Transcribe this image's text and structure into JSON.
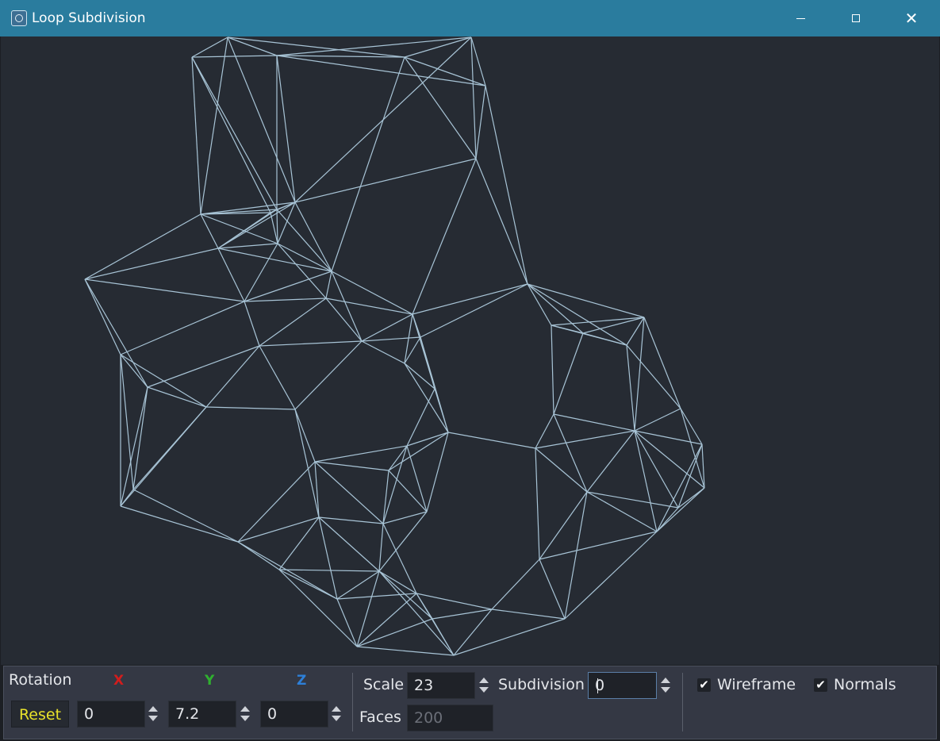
{
  "window": {
    "title": "Loop Subdivision",
    "icon": "app-icon",
    "close_glyph": "✕"
  },
  "colors": {
    "titlebar": "#2a7c9e",
    "viewport_bg": "#262b33",
    "wire": "#a8c4d6",
    "axis_x": "#d21d1d",
    "axis_y": "#2fb02f",
    "axis_z": "#2d7fd8",
    "reset_text": "#e8e22b"
  },
  "viewport": {
    "mesh": "wireframe-bunny"
  },
  "controls": {
    "rotation": {
      "label": "Rotation",
      "x_label": "X",
      "y_label": "Y",
      "z_label": "Z",
      "reset_label": "Reset",
      "x_value": "0",
      "y_value": "7.2",
      "z_value": "0"
    },
    "scale": {
      "label": "Scale",
      "value": "23"
    },
    "subdivision": {
      "label": "Subdivision",
      "value": "0"
    },
    "faces": {
      "label": "Faces",
      "value": "200"
    },
    "wireframe": {
      "label": "Wireframe",
      "checked": true
    },
    "normals": {
      "label": "Normals",
      "checked": true
    },
    "check_glyph": "✔"
  }
}
